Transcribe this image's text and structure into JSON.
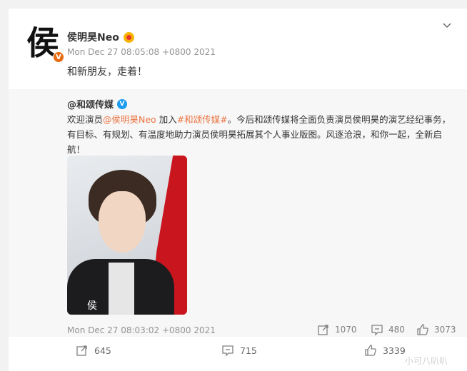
{
  "post": {
    "avatar_glyph": "侯",
    "avatar_badge": "V",
    "username": "侯明昊Neo",
    "timestamp": "Mon Dec 27 08:05:08 +0800 2021",
    "text": "和新朋友，走着！"
  },
  "repost": {
    "username": "@和颂传媒",
    "verified_badge": "V",
    "text_prefix": "欢迎演员",
    "mention": "@侯明昊Neo",
    "text_mid": " 加入",
    "hashtag": "#和颂传媒#",
    "text_suffix": "。今后和颂传媒将全面负责演员侯明昊的演艺经纪事务，有目标、有规划、有温度地助力演员侯明昊拓展其个人事业版图。风逐沧浪，和你一起，全新启航！",
    "photo_signature": "侯",
    "timestamp": "Mon Dec 27 08:03:02 +0800 2021",
    "reposts": "1070",
    "comments": "480",
    "likes": "3073"
  },
  "toolbar": {
    "reposts": "645",
    "comments": "715",
    "likes": "3339"
  },
  "watermark": "小可八叭叭",
  "colors": {
    "link": "#eb7340",
    "verified_blue": "#1a9bf0",
    "verified_orange": "#e86b12",
    "muted": "#939393"
  }
}
